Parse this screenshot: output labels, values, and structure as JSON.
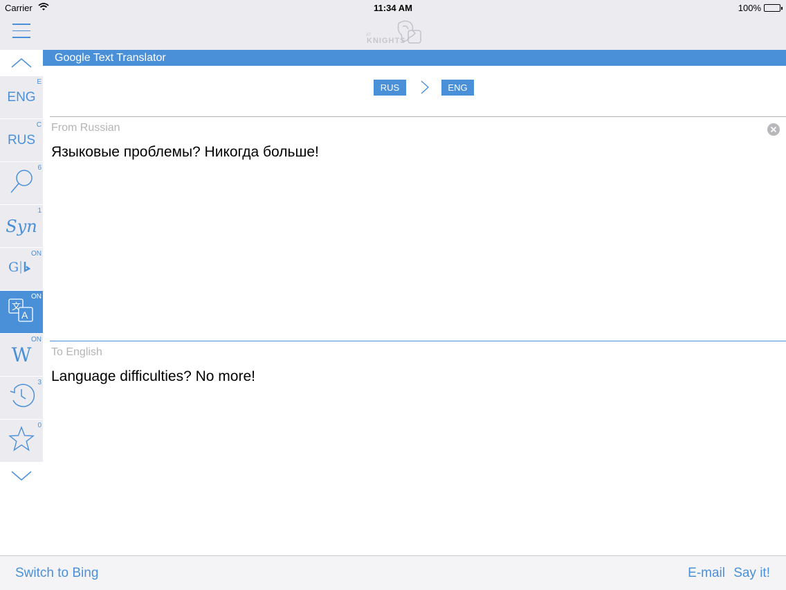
{
  "status": {
    "carrier": "Carrier",
    "time": "11:34 AM",
    "battery": "100%"
  },
  "navbar": {
    "menu_icon": "hamburger-icon",
    "logo_text": "KNIGHTS"
  },
  "sidebar": {
    "items": [
      {
        "label": "ENG",
        "badge": "E",
        "icon": "eng-text"
      },
      {
        "label": "RUS",
        "badge": "C",
        "icon": "rus-text"
      },
      {
        "label": "",
        "badge": "6",
        "icon": "magnifier-icon"
      },
      {
        "label": "Syn",
        "badge": "1",
        "icon": "synonyms-icon"
      },
      {
        "label": "G | b",
        "badge": "ON",
        "icon": "google-bing-icon"
      },
      {
        "label": "",
        "badge": "ON",
        "icon": "translate-icon"
      },
      {
        "label": "W",
        "badge": "ON",
        "icon": "wikipedia-icon"
      },
      {
        "label": "",
        "badge": "3",
        "icon": "history-icon"
      },
      {
        "label": "",
        "badge": "0",
        "icon": "star-icon"
      }
    ]
  },
  "main": {
    "title": "Google Text Translator",
    "from_lang": "RUS",
    "to_lang": "ENG",
    "from_label": "From Russian",
    "from_text": "Языковые проблемы? Никогда больше!",
    "to_label": "To English",
    "to_text": "Language difficulties? No more!"
  },
  "bottom": {
    "switch": "Switch to Bing",
    "email": "E-mail",
    "say": "Say it!"
  },
  "colors": {
    "accent": "#4a90d9",
    "bar_bg": "#ebebf0"
  }
}
